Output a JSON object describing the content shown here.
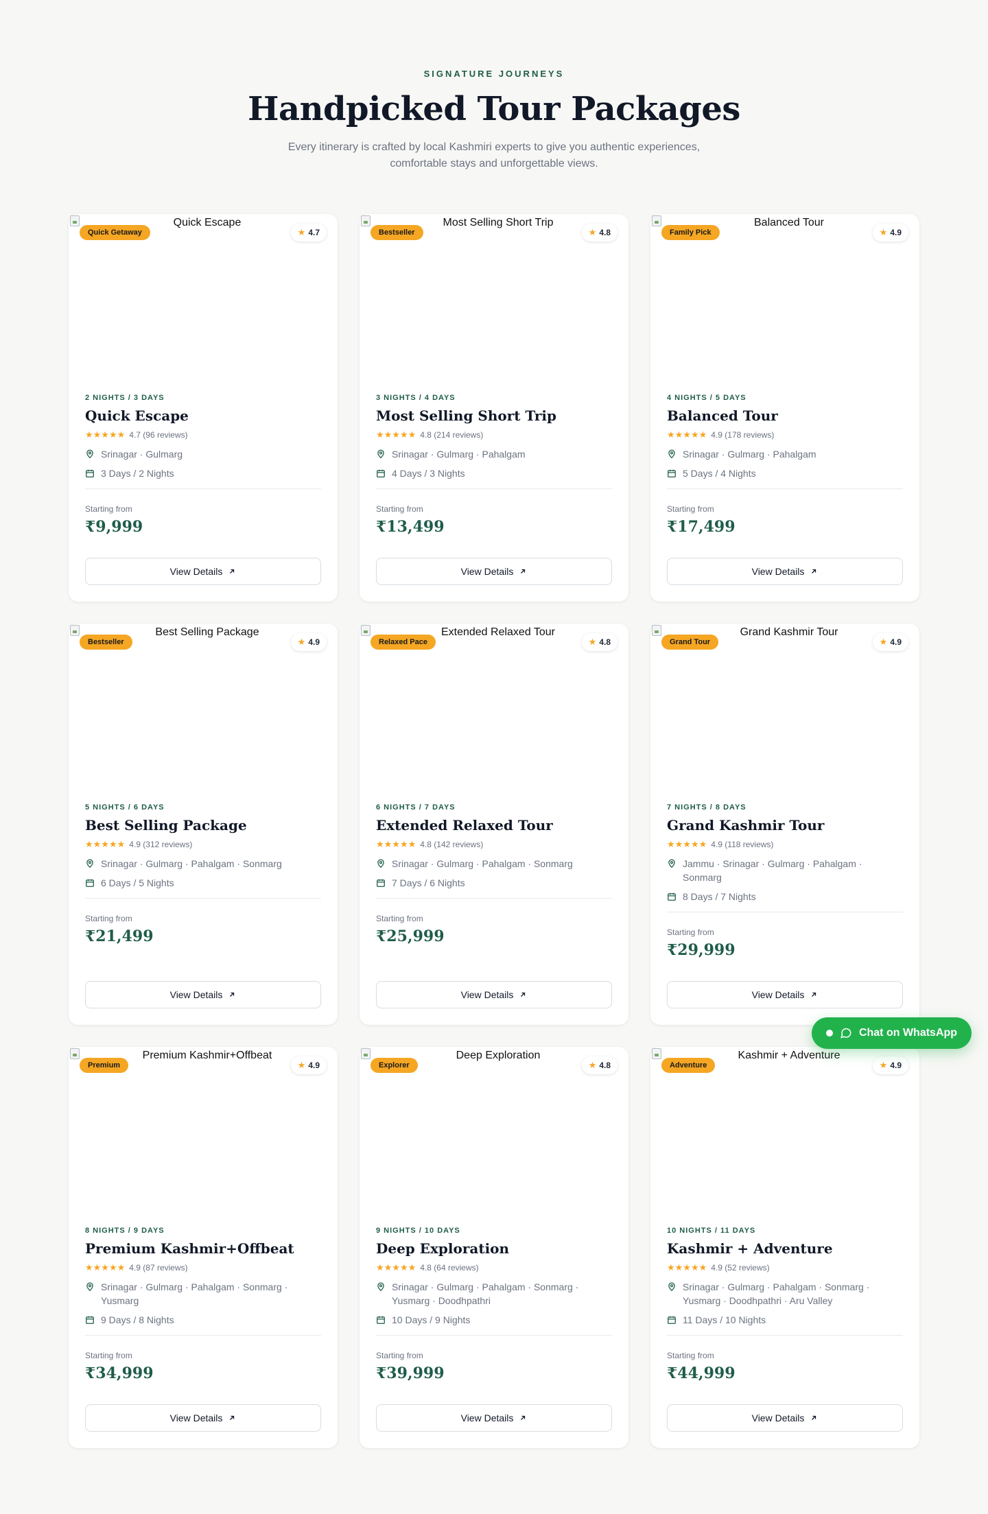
{
  "section": {
    "eyebrow": "SIGNATURE JOURNEYS",
    "title": "Handpicked Tour Packages",
    "subtitle": "Every itinerary is crafted by local Kashmiri experts to give you authentic experiences, comfortable stays and unforgettable views."
  },
  "common": {
    "starting_from": "Starting from",
    "view_details": "View Details",
    "stars": "★★★★★"
  },
  "packages": [
    {
      "image_alt": "Quick Escape",
      "badge": "Quick Getaway",
      "rating": "4.7",
      "duration": "2 NIGHTS / 3 DAYS",
      "name": "Quick Escape",
      "reviews": "4.7 (96 reviews)",
      "route": "Srinagar · Gulmarg",
      "stay": "3 Days / 2 Nights",
      "price": "₹9,999"
    },
    {
      "image_alt": "Most Selling Short Trip",
      "badge": "Bestseller",
      "rating": "4.8",
      "duration": "3 NIGHTS / 4 DAYS",
      "name": "Most Selling Short Trip",
      "reviews": "4.8 (214 reviews)",
      "route": "Srinagar · Gulmarg · Pahalgam",
      "stay": "4 Days / 3 Nights",
      "price": "₹13,499"
    },
    {
      "image_alt": "Balanced Tour",
      "badge": "Family Pick",
      "rating": "4.9",
      "duration": "4 NIGHTS / 5 DAYS",
      "name": "Balanced Tour",
      "reviews": "4.9 (178 reviews)",
      "route": "Srinagar · Gulmarg · Pahalgam",
      "stay": "5 Days / 4 Nights",
      "price": "₹17,499"
    },
    {
      "image_alt": "Best Selling Package",
      "badge": "Bestseller",
      "rating": "4.9",
      "duration": "5 NIGHTS / 6 DAYS",
      "name": "Best Selling Package",
      "reviews": "4.9 (312 reviews)",
      "route": "Srinagar · Gulmarg · Pahalgam · Sonmarg",
      "stay": "6 Days / 5 Nights",
      "price": "₹21,499"
    },
    {
      "image_alt": "Extended Relaxed Tour",
      "badge": "Relaxed Pace",
      "rating": "4.8",
      "duration": "6 NIGHTS / 7 DAYS",
      "name": "Extended Relaxed Tour",
      "reviews": "4.8 (142 reviews)",
      "route": "Srinagar · Gulmarg · Pahalgam · Sonmarg",
      "stay": "7 Days / 6 Nights",
      "price": "₹25,999"
    },
    {
      "image_alt": "Grand Kashmir Tour",
      "badge": "Grand Tour",
      "rating": "4.9",
      "duration": "7 NIGHTS / 8 DAYS",
      "name": "Grand Kashmir Tour",
      "reviews": "4.9 (118 reviews)",
      "route": "Jammu · Srinagar · Gulmarg · Pahalgam · Sonmarg",
      "stay": "8 Days / 7 Nights",
      "price": "₹29,999"
    },
    {
      "image_alt": "Premium Kashmir+Offbeat",
      "badge": "Premium",
      "rating": "4.9",
      "duration": "8 NIGHTS / 9 DAYS",
      "name": "Premium Kashmir+Offbeat",
      "reviews": "4.9 (87 reviews)",
      "route": "Srinagar · Gulmarg · Pahalgam · Sonmarg · Yusmarg",
      "stay": "9 Days / 8 Nights",
      "price": "₹34,999"
    },
    {
      "image_alt": "Deep Exploration",
      "badge": "Explorer",
      "rating": "4.8",
      "duration": "9 NIGHTS / 10 DAYS",
      "name": "Deep Exploration",
      "reviews": "4.8 (64 reviews)",
      "route": "Srinagar · Gulmarg · Pahalgam · Sonmarg · Yusmarg · Doodhpathri",
      "stay": "10 Days / 9 Nights",
      "price": "₹39,999"
    },
    {
      "image_alt": "Kashmir + Adventure",
      "badge": "Adventure",
      "rating": "4.9",
      "duration": "10 NIGHTS / 11 DAYS",
      "name": "Kashmir + Adventure",
      "reviews": "4.9 (52 reviews)",
      "route": "Srinagar · Gulmarg · Pahalgam · Sonmarg · Yusmarg · Doodhpathri · Aru Valley",
      "stay": "11 Days / 10 Nights",
      "price": "₹44,999"
    }
  ],
  "whatsapp": {
    "label": "Chat on WhatsApp"
  },
  "colors": {
    "accent": "#1f5c4a",
    "badge": "#f5a623",
    "whatsapp": "#22b24c"
  }
}
